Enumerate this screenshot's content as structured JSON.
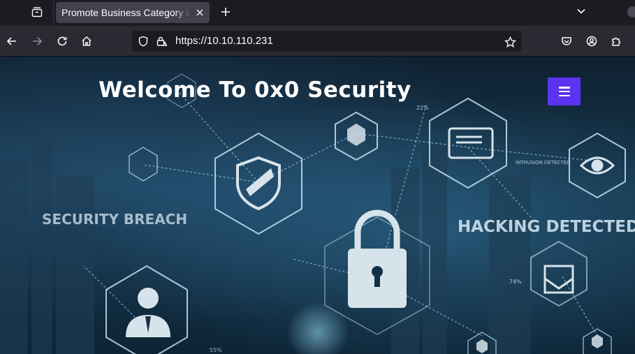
{
  "browser": {
    "tab": {
      "title": "Promote Business Category E"
    },
    "url": "https://10.10.110.231"
  },
  "page": {
    "site_title": "Welcome To 0x0 Security",
    "hero_labels": {
      "security_breach": "SECURITY BREACH",
      "hacking_detected": "HACKING DETECTED",
      "intrusion_detected": "INTRUSION DETECTED",
      "pct_22": "22%",
      "pct_74": "74%",
      "pct_55": "55%"
    },
    "accent_color": "#5b33f0"
  }
}
